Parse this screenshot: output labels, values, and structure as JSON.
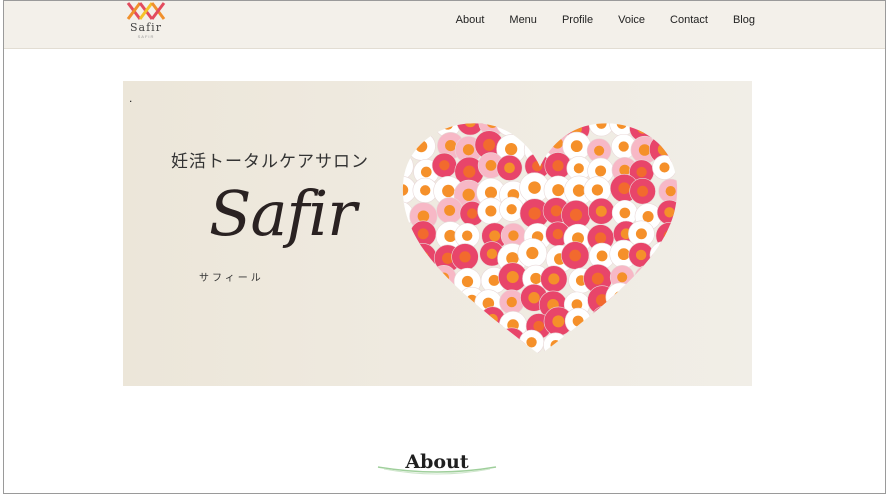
{
  "brand": {
    "name": "Safir",
    "sub": "SAFIR"
  },
  "nav": {
    "items": [
      {
        "label": "About"
      },
      {
        "label": "Menu"
      },
      {
        "label": "Profile"
      },
      {
        "label": "Voice"
      },
      {
        "label": "Contact"
      },
      {
        "label": "Blog"
      }
    ]
  },
  "hero": {
    "dot": ".",
    "catchphrase": "妊活トータルケアサロン",
    "script_name": "Safir",
    "kana": "サフィール",
    "image": "heart-of-daisies"
  },
  "about": {
    "title": "About"
  },
  "colors": {
    "header_bg": "#f3f0ea",
    "hero_bg": "#ece6d9",
    "accent_green": "#8fc28c",
    "flower_pink": "#e8456a",
    "flower_orange": "#f5902a"
  },
  "icons": [
    "safir-logo-icon",
    "heart-flowers-image",
    "decorative-line-icon"
  ]
}
